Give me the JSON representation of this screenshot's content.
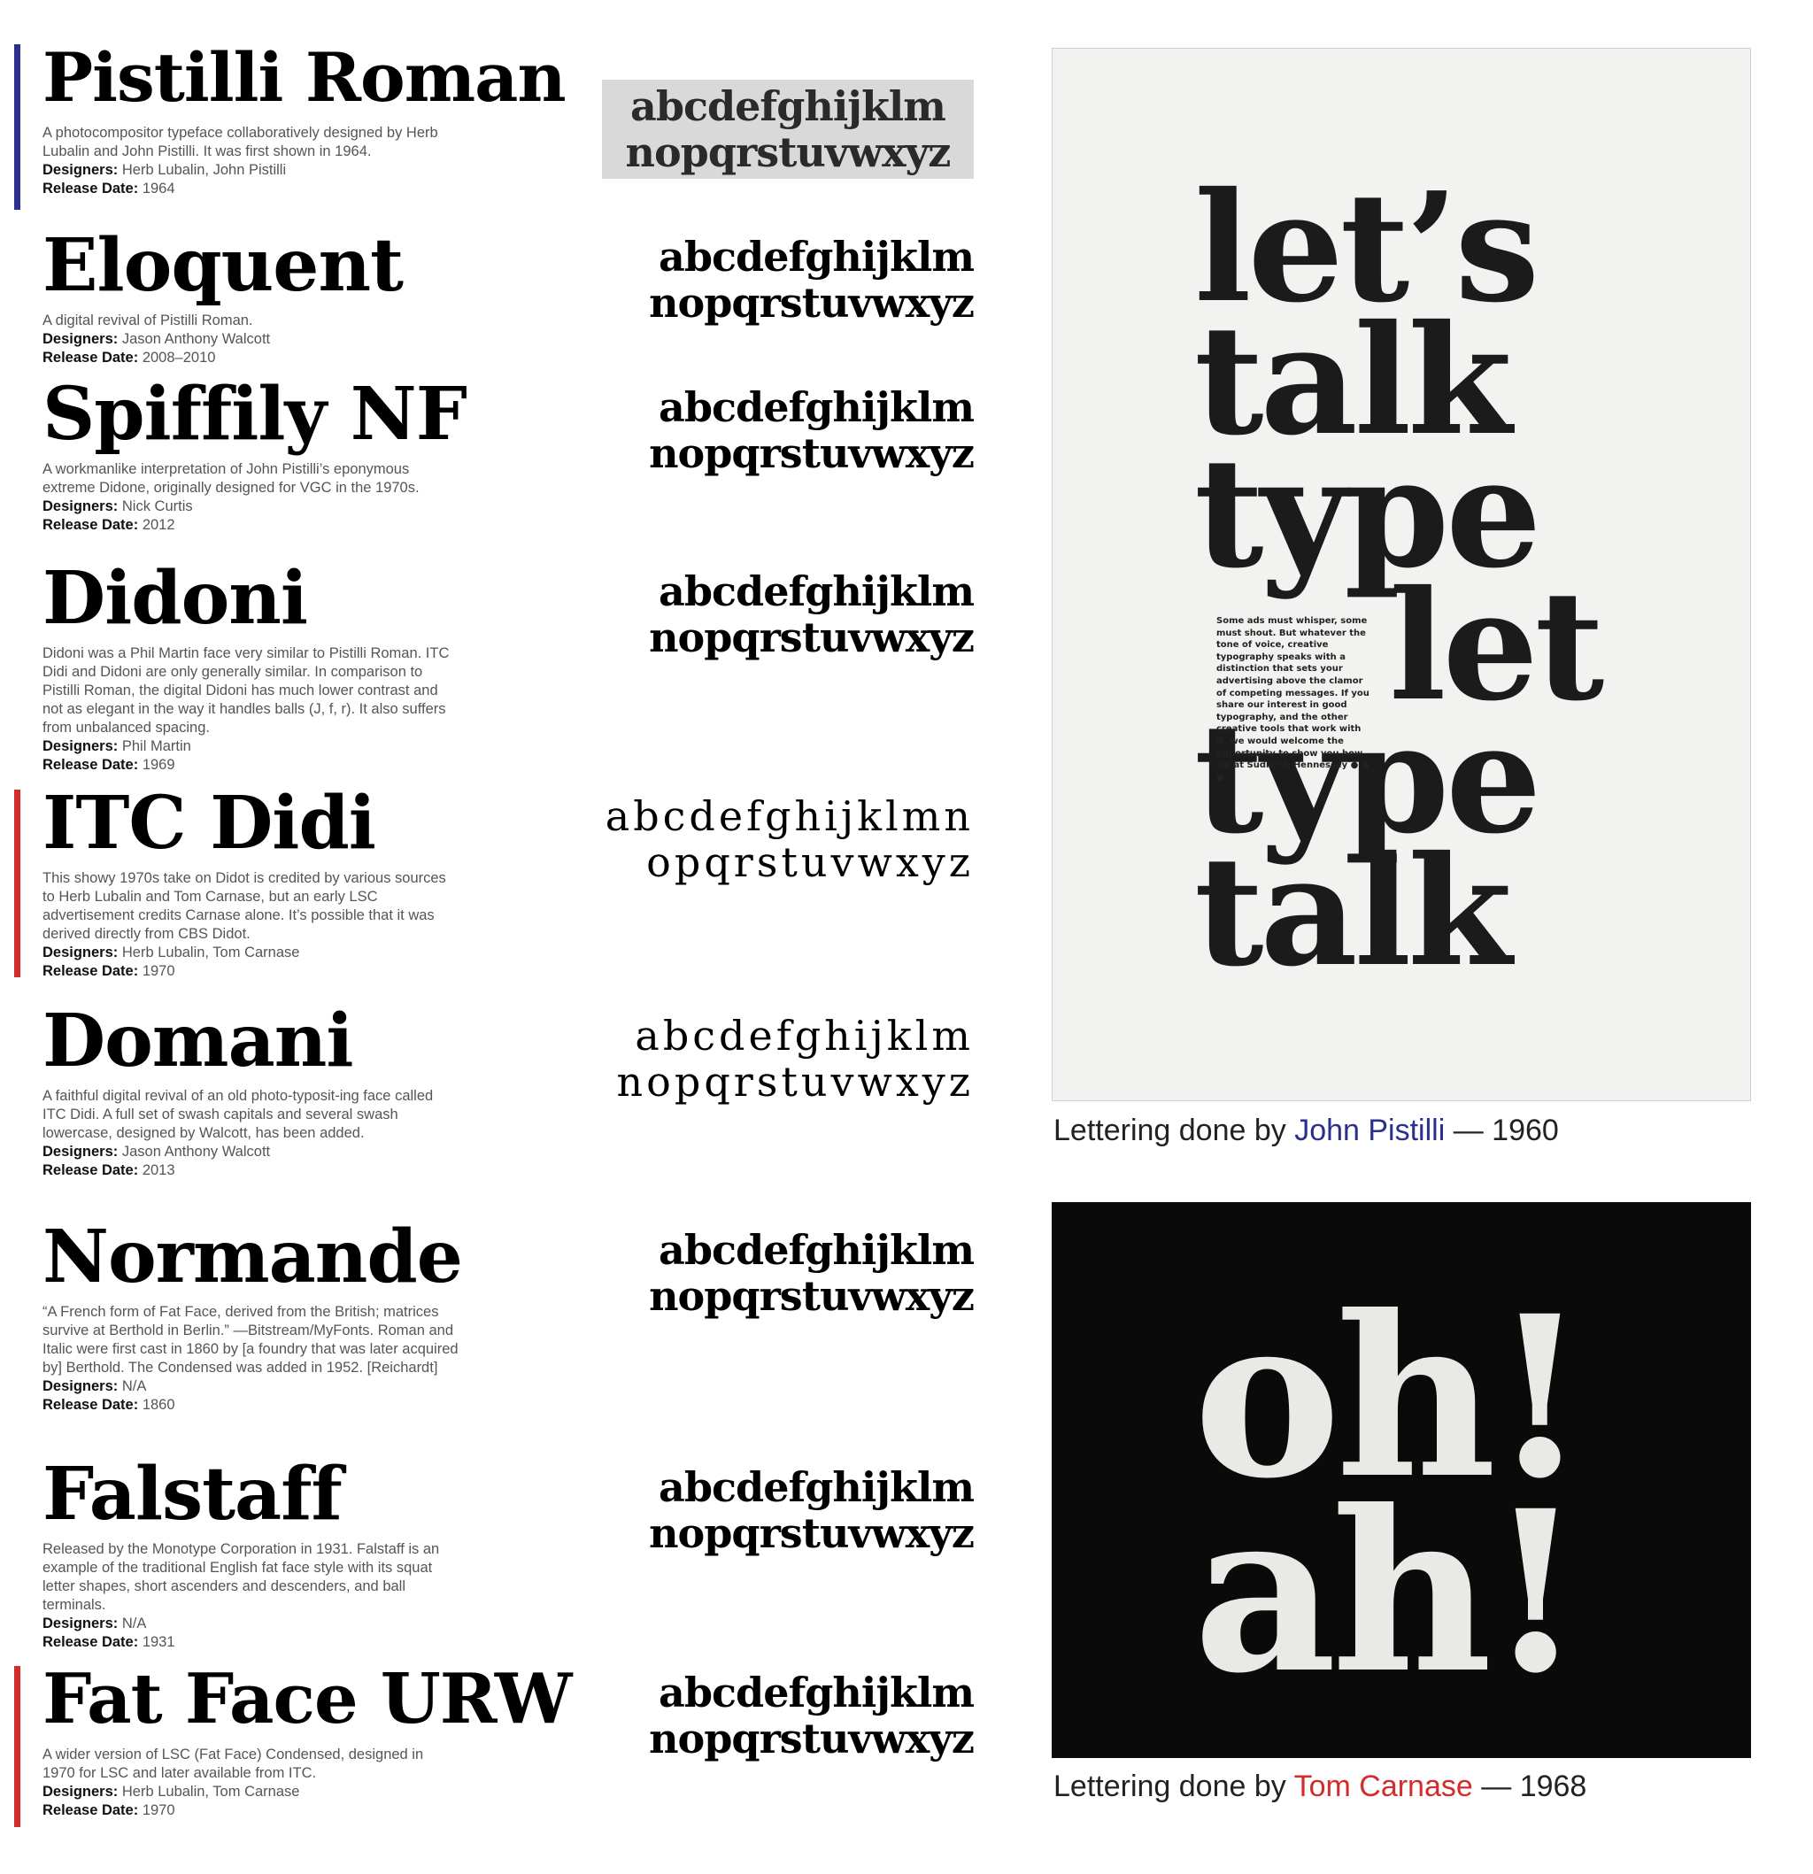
{
  "colors": {
    "accent_blue": "#2b2f8f",
    "accent_red": "#d42b2b",
    "panel_black": "#0a0a0a"
  },
  "typefaces": [
    {
      "name": "Pistilli Roman",
      "accent": "blue",
      "description": "A photocompositor typeface collaboratively designed by Herb Lubalin and John Pistilli. It was first shown in 1964.",
      "designers_label": "Designers:",
      "designers": "Herb Lubalin, John Pistilli",
      "release_label": "Release Date:",
      "release": "1964",
      "alphabet": [
        "abcdefghijklm",
        "nopqrstuvwxyz"
      ]
    },
    {
      "name": "Eloquent",
      "accent": "",
      "description": "A digital revival of Pistilli Roman.",
      "designers_label": "Designers:",
      "designers": "Jason Anthony Walcott",
      "release_label": "Release Date:",
      "release": "2008–2010",
      "alphabet": [
        "abcdefghijklm",
        "nopqrstuvwxyz"
      ]
    },
    {
      "name": "Spiffily NF",
      "accent": "",
      "description": "A workmanlike interpretation of John Pistilli’s eponymous extreme Didone, originally designed for VGC in the 1970s.",
      "designers_label": "Designers:",
      "designers": "Nick Curtis",
      "release_label": "Release Date:",
      "release": "2012",
      "alphabet": [
        "abcdefghijklm",
        "nopqrstuvwxyz"
      ]
    },
    {
      "name": "Didoni",
      "accent": "",
      "description": "Didoni was a Phil Martin face very similar to Pistilli Roman. ITC Didi and Didoni are only generally similar. In comparison to Pistilli Roman, the digital Didoni has much lower contrast and not as elegant in the way it handles balls (J, f, r). It also suffers from unbalanced spacing.",
      "designers_label": "Designers:",
      "designers": "Phil Martin",
      "release_label": "Release Date:",
      "release": "1969",
      "alphabet": [
        "abcdefghijklm",
        "nopqrstuvwxyz"
      ]
    },
    {
      "name": "ITC Didi",
      "accent": "red",
      "description": "This showy 1970s take on Didot is credited by various sources to Herb Lubalin and Tom Carnase, but an early LSC advertisement credits Carnase alone. It’s possible that it was derived directly from CBS Didot.",
      "designers_label": "Designers:",
      "designers": "Herb Lubalin, Tom Carnase",
      "release_label": "Release Date:",
      "release": "1970",
      "alphabet": [
        "abcdefghijklmn",
        "opqrstuvwxyz"
      ]
    },
    {
      "name": "Domani",
      "accent": "",
      "description": "A faithful digital revival of an old photo-typosit-ing face called ITC Didi. A full set of swash capitals and several swash lowercase, designed by Walcott, has been added.",
      "designers_label": "Designers:",
      "designers": "Jason Anthony Walcott",
      "release_label": "Release Date:",
      "release": "2013",
      "alphabet": [
        "abcdefghijklm",
        "nopqrstuvwxyz"
      ]
    },
    {
      "name": "Normande",
      "accent": "",
      "description": "“A French form of Fat Face, derived from the British; matrices survive at Berthold in Berlin.” —Bitstream/MyFonts. Roman and Italic were first cast in 1860 by [a foundry that was later acquired by] Berthold. The Condensed was added in 1952. [Reichardt]",
      "designers_label": "Designers:",
      "designers": "N/A",
      "release_label": "Release Date:",
      "release": "1860",
      "alphabet": [
        "abcdefghijklm",
        "nopqrstuvwxyz"
      ]
    },
    {
      "name": "Falstaff",
      "accent": "",
      "description": "Released by the Monotype Corporation in 1931. Falstaff is an example of the traditional English fat face style with its squat letter shapes, short ascenders and descenders, and ball terminals.",
      "designers_label": "Designers:",
      "designers": "N/A",
      "release_label": "Release Date:",
      "release": "1931",
      "alphabet": [
        "abcdefghijklm",
        "nopqrstuvwxyz"
      ]
    },
    {
      "name": "Fat Face URW",
      "accent": "red",
      "description": "A wider version of LSC (Fat Face) Condensed, designed in 1970 for LSC and later available from ITC.",
      "designers_label": "Designers:",
      "designers": "Herb Lubalin, Tom Carnase",
      "release_label": "Release Date:",
      "release": "1970",
      "alphabet": [
        "abcdefghijklm",
        "nopqrstuvwxyz"
      ]
    }
  ],
  "poster": {
    "lines": [
      "let’s",
      "talk",
      "type",
      "let",
      "type",
      "talk"
    ],
    "body_copy": "Some ads must whisper, some must shout. But whatever the tone of voice, creative typography speaks with a distinction that sets your advertising above the clamor of competing messages. If you share our interest in good typography, and the other creative tools that work with it, we would welcome the opportunity to show you how we at Sudler & Hennessey ● ● ●"
  },
  "caption_pistilli": {
    "prefix": "Lettering done by ",
    "name": "John Pistilli",
    "suffix": " — 1960"
  },
  "black_panel": {
    "lines": [
      "oh!",
      "ah!"
    ]
  },
  "caption_carnase": {
    "prefix": "Lettering done by ",
    "name": "Tom Carnase",
    "suffix": " — 1968"
  }
}
